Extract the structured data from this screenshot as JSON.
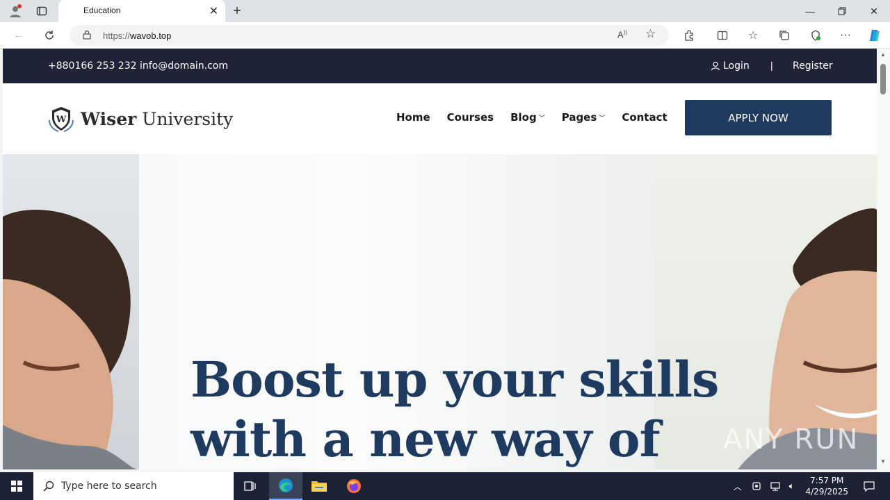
{
  "browser": {
    "tab_title": "Education",
    "url_prefix": "https://",
    "url_host": "wavob.top"
  },
  "site": {
    "topbar": {
      "contact": "+880166 253 232 info@domain.com",
      "login": "Login",
      "divider": "|",
      "register": "Register"
    },
    "logo": {
      "bold": "Wiser",
      "rest": " University",
      "mark_letter": "W"
    },
    "nav": {
      "home": "Home",
      "courses": "Courses",
      "blog": "Blog",
      "pages": "Pages",
      "contact": "Contact",
      "apply": "APPLY NOW"
    },
    "hero": {
      "line1": "Boost up your skills",
      "line2": "with a new way of"
    }
  },
  "watermark": "ANY RUN",
  "taskbar": {
    "search_placeholder": "Type here to search",
    "time": "7:57 PM",
    "date": "4/29/2025"
  },
  "colors": {
    "topbar_bg": "#1f2437",
    "brand_navy": "#1f3a5f"
  }
}
